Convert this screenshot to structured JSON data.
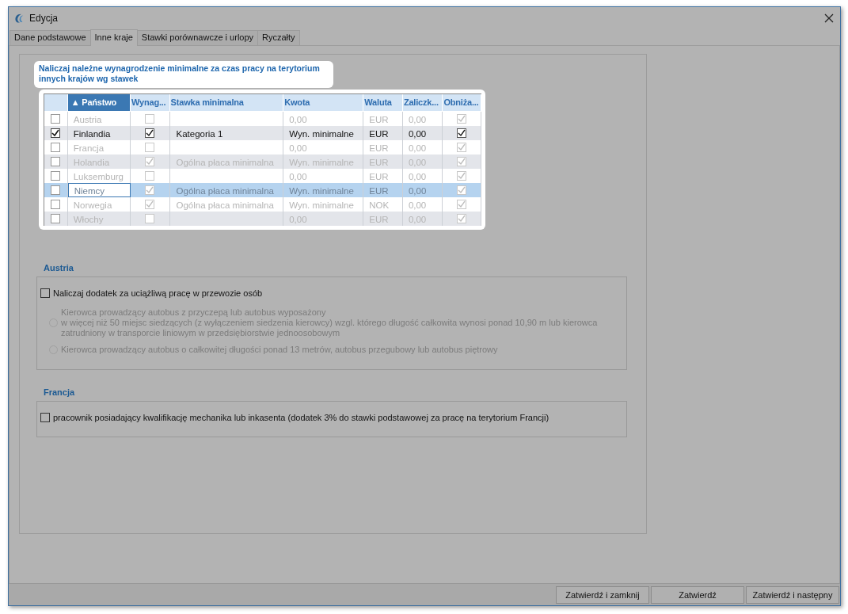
{
  "window": {
    "title": "Edycja"
  },
  "tabs": [
    {
      "label": "Dane podstawowe",
      "selected": false
    },
    {
      "label": "Inne kraje",
      "selected": true
    },
    {
      "label": "Stawki porównawcze i urlopy",
      "selected": false
    },
    {
      "label": "Ryczałty",
      "selected": false
    }
  ],
  "callout": "Naliczaj należne wynagrodzenie minimalne za czas pracy na terytorium innych krajów wg stawek",
  "table": {
    "columns": [
      {
        "sorted": false
      },
      {
        "label": "▲ Państwo",
        "sorted": true
      },
      {
        "label": "Wynag...",
        "sorted": false
      },
      {
        "label": "Stawka minimalna",
        "sorted": false
      },
      {
        "label": "Kwota",
        "sorted": false
      },
      {
        "label": "Waluta",
        "sorted": false
      },
      {
        "label": "Zaliczk...",
        "sorted": false
      },
      {
        "label": "Obniża...",
        "sorted": false
      }
    ],
    "rows": [
      {
        "checked": false,
        "country": "Austria",
        "wynag": false,
        "kwota": "0,00",
        "waluta": "EUR",
        "zaliczka": "0,00",
        "obniza": true,
        "selected": false
      },
      {
        "checked": true,
        "country": "Finlandia",
        "wynag": true,
        "stawka": "Kategoria 1",
        "kwota": "Wyn. minimalne",
        "waluta": "EUR",
        "zaliczka": "0,00",
        "obniza": true,
        "selected": false
      },
      {
        "checked": false,
        "country": "Francja",
        "wynag": false,
        "kwota": "0,00",
        "waluta": "EUR",
        "zaliczka": "0,00",
        "obniza": true,
        "selected": false
      },
      {
        "checked": false,
        "country": "Holandia",
        "wynag": true,
        "stawka": "Ogólna płaca minimalna",
        "kwota": "Wyn. minimalne",
        "waluta": "EUR",
        "zaliczka": "0,00",
        "obniza": true,
        "selected": false
      },
      {
        "checked": false,
        "country": "Luksemburg",
        "wynag": false,
        "kwota": "0,00",
        "waluta": "EUR",
        "zaliczka": "0,00",
        "obniza": true,
        "selected": false
      },
      {
        "checked": false,
        "country": "Niemcy",
        "wynag": true,
        "stawka": "Ogólna płaca minimalna",
        "kwota": "Wyn. minimalne",
        "waluta": "EUR",
        "zaliczka": "0,00",
        "obniza": true,
        "selected": true
      },
      {
        "checked": false,
        "country": "Norwegia",
        "wynag": true,
        "stawka": "Ogólna płaca minimalna",
        "kwota": "Wyn. minimalne",
        "waluta": "NOK",
        "zaliczka": "0,00",
        "obniza": true,
        "selected": false
      },
      {
        "checked": false,
        "country": "Włochy",
        "wynag": false,
        "kwota": "0,00",
        "waluta": "EUR",
        "zaliczka": "0,00",
        "obniza": true,
        "selected": false
      }
    ]
  },
  "sections": [
    {
      "title": "Austria",
      "items": [
        {
          "kind": "checkbox",
          "label": "Naliczaj dodatek za uciążliwą pracę w przewozie osób",
          "checked": false,
          "disabled": false
        },
        {
          "kind": "radio",
          "lines": [
            "Kierowca prowadzący autobus z przyczepą lub autobus wyposażony",
            " w więcej niż 50 miejsc siedzących (z wyłączeniem siedzenia kierowcy) wzgl. którego długość całkowita wynosi ponad 10,90 m lub kierowca",
            "zatrudniony w transporcie liniowym w przedsiębiorstwie jednoosobowym"
          ],
          "checked": false,
          "disabled": true
        },
        {
          "kind": "radio",
          "lines": [
            "Kierowca prowadzący autobus o całkowitej długości ponad 13 metrów, autobus przegubowy lub autobus piętrowy"
          ],
          "checked": false,
          "disabled": true
        }
      ]
    },
    {
      "title": "Francja",
      "items": [
        {
          "kind": "checkbox",
          "label": "pracownik posiadający kwalifikację mechanika lub inkasenta (dodatek 3% do stawki podstawowej za pracę na terytorium Francji)",
          "checked": false,
          "disabled": false
        }
      ]
    }
  ],
  "buttons": [
    "Zatwierdź i zamknij",
    "Zatwierdź",
    "Zatwierdź i następny"
  ]
}
